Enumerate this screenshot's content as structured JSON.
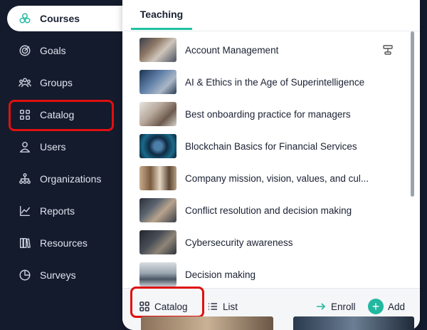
{
  "sidebar": {
    "items": [
      {
        "label": "Courses",
        "icon": "courses-icon",
        "active": true
      },
      {
        "label": "Goals",
        "icon": "goals-icon"
      },
      {
        "label": "Groups",
        "icon": "groups-icon"
      },
      {
        "label": "Catalog",
        "icon": "catalog-icon"
      },
      {
        "label": "Users",
        "icon": "users-icon"
      },
      {
        "label": "Organizations",
        "icon": "organizations-icon"
      },
      {
        "label": "Reports",
        "icon": "reports-icon"
      },
      {
        "label": "Resources",
        "icon": "resources-icon"
      },
      {
        "label": "Surveys",
        "icon": "surveys-icon"
      }
    ]
  },
  "panel": {
    "tab": "Teaching",
    "courses": [
      {
        "title": "Account Management"
      },
      {
        "title": "AI & Ethics in the Age of Superintelligence"
      },
      {
        "title": "Best onboarding practice for managers"
      },
      {
        "title": "Blockchain Basics for Financial Services"
      },
      {
        "title": "Company mission, vision, values, and cul..."
      },
      {
        "title": "Conflict resolution and decision making"
      },
      {
        "title": "Cybersecurity awareness"
      },
      {
        "title": "Decision making"
      }
    ]
  },
  "footer": {
    "catalog": "Catalog",
    "list": "List",
    "enroll": "Enroll",
    "add": "Add"
  },
  "colors": {
    "sidebar_bg": "#141b2d",
    "accent": "#22b8a0",
    "highlight": "#e01010"
  }
}
